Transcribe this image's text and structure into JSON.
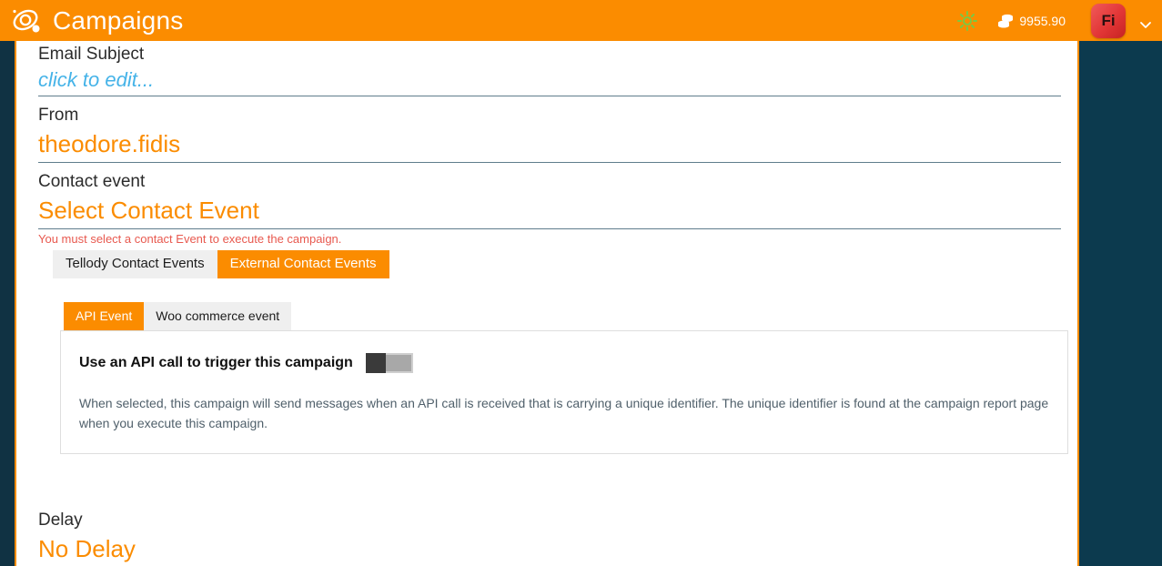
{
  "header": {
    "logo_icon": "atom-orbit-logo-icon",
    "title": "Campaigns",
    "theme_icon": "sun-icon",
    "credits_icon": "coins-icon",
    "credits_value": "9955.90",
    "avatar_initials": "Fi",
    "avatar_menu_icon": "chevron-down-icon",
    "brand_color": "#fb8c00",
    "avatar_color": "#e23636"
  },
  "form": {
    "email_subject": {
      "label": "Email Subject",
      "value": "click to edit..."
    },
    "from": {
      "label": "From",
      "value": "theodore.fidis"
    },
    "contact_event": {
      "label": "Contact event",
      "value": "Select Contact Event",
      "error": "You must select a contact Event to execute the campaign."
    },
    "delay": {
      "label": "Delay",
      "value": "No Delay"
    }
  },
  "outer_tabs": [
    {
      "label": "Tellody Contact Events",
      "active": false
    },
    {
      "label": "External Contact Events",
      "active": true
    }
  ],
  "inner_tabs": [
    {
      "label": "API Event",
      "active": true
    },
    {
      "label": "Woo commerce event",
      "active": false
    }
  ],
  "api_panel": {
    "title": "Use an API call to trigger this campaign",
    "toggle_state": "off",
    "description": "When selected, this campaign will send messages when an API call is received that is carrying a unique identifier. The unique identifier is found at the campaign report page when you execute this campaign."
  }
}
